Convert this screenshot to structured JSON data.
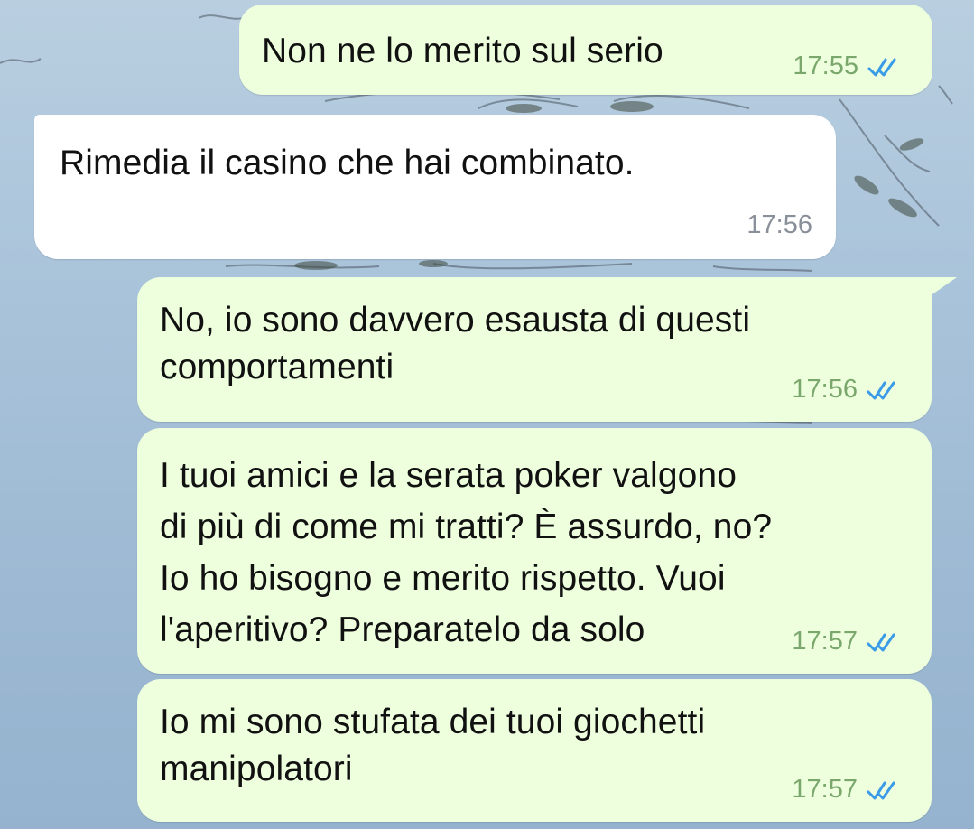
{
  "messages": [
    {
      "direction": "outgoing",
      "text": "Non ne lo merito sul serio",
      "time": "17:55",
      "status": "read"
    },
    {
      "direction": "incoming",
      "text": "Rimedia il casino che hai combinato.",
      "time": "17:56"
    },
    {
      "direction": "outgoing",
      "text": "No, io sono davvero esausta di questi\ncomportamenti",
      "time": "17:56",
      "status": "read"
    },
    {
      "direction": "outgoing",
      "text": "I tuoi amici e la serata poker valgono\ndi più di come mi tratti? È assurdo, no?\nIo ho bisogno e merito rispetto. Vuoi\nl'aperitivo? Preparatelo da solo",
      "time": "17:57",
      "status": "read"
    },
    {
      "direction": "outgoing",
      "text": "Io mi sono stufata dei tuoi giochetti\nmanipolatori",
      "time": "17:57",
      "status": "read"
    }
  ],
  "icons": {
    "read_status": "double-check-icon"
  },
  "colors": {
    "outgoing_bubble": "#eeffde",
    "incoming_bubble": "#ffffff",
    "read_tick": "#3a9be6",
    "outgoing_time": "#7aa76b",
    "incoming_time": "#8a9099"
  }
}
